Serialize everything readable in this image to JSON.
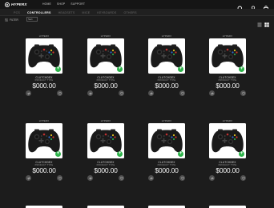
{
  "brand": {
    "name": "HYPERX"
  },
  "topnav": {
    "items": [
      "HOME",
      "SHOP",
      "SUPPORT"
    ]
  },
  "subnav": {
    "tabs": [
      "PCS",
      "CONTROLLERS",
      "HEADSETS",
      "MICE",
      "KEYBOARDS",
      "OTHERS"
    ],
    "active_index": 1
  },
  "filterbar": {
    "filter_label": "FILTER",
    "sort_label": "Sort"
  },
  "colors": {
    "accent": "#2db34a",
    "background": "#1c1c1c"
  },
  "products": [
    {
      "brand": "HYPERX",
      "name": "CLUTCHDEX",
      "sub": "PRODUCT TYPE",
      "price": "$000.00"
    },
    {
      "brand": "HYPERX",
      "name": "CLUTCHDEX",
      "sub": "PRODUCT TYPE",
      "price": "$000.00"
    },
    {
      "brand": "HYPERX",
      "name": "CLUTCHDEX",
      "sub": "PRODUCT TYPE",
      "price": "$000.00"
    },
    {
      "brand": "HYPERX",
      "name": "CLUTCHDEX",
      "sub": "PRODUCT TYPE",
      "price": "$000.00"
    },
    {
      "brand": "HYPERX",
      "name": "CLUTCHDEX",
      "sub": "PRODUCT TYPE",
      "price": "$000.00"
    },
    {
      "brand": "HYPERX",
      "name": "CLUTCHDEX",
      "sub": "PRODUCT TYPE",
      "price": "$000.00"
    },
    {
      "brand": "HYPERX",
      "name": "CLUTCHDEX",
      "sub": "PRODUCT TYPE",
      "price": "$000.00"
    },
    {
      "brand": "HYPERX",
      "name": "CLUTCHDEX",
      "sub": "PRODUCT TYPE",
      "price": "$000.00"
    }
  ],
  "icons": {
    "add": "+",
    "compare": "compare-icon",
    "wishlist": "heart-icon"
  }
}
